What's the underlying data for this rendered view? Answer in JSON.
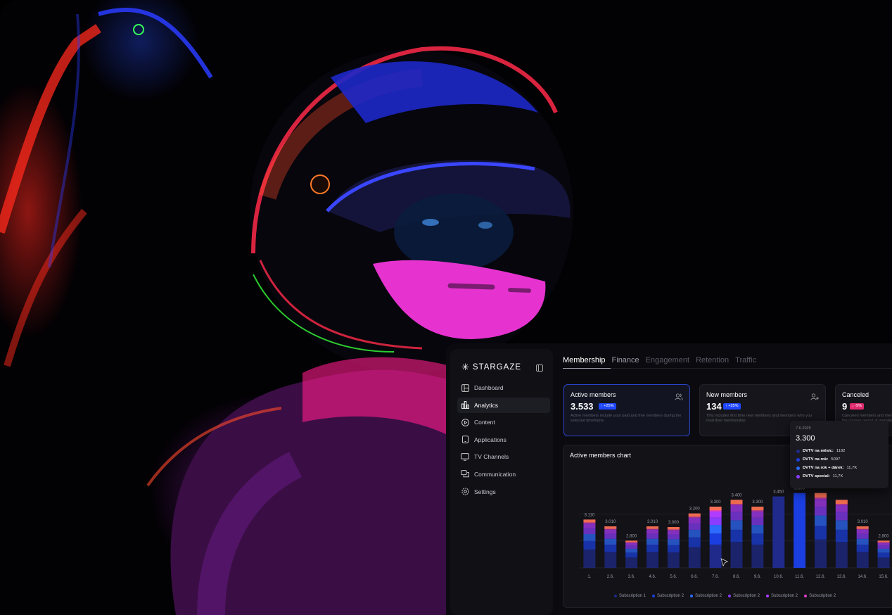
{
  "brand": {
    "name": "STARGAZE"
  },
  "sidebar": {
    "items": [
      {
        "label": "Dashboard",
        "icon": "dashboard-icon"
      },
      {
        "label": "Analytics",
        "icon": "analytics-icon",
        "active": true
      },
      {
        "label": "Content",
        "icon": "play-icon"
      },
      {
        "label": "Applications",
        "icon": "tablet-icon"
      },
      {
        "label": "TV Channels",
        "icon": "tv-icon"
      },
      {
        "label": "Communication",
        "icon": "chat-icon"
      },
      {
        "label": "Settings",
        "icon": "gear-icon"
      }
    ]
  },
  "tabs": [
    "Membership",
    "Finance",
    "Engagement",
    "Retention",
    "Traffic"
  ],
  "cards": [
    {
      "title": "Active members",
      "value": "3.533",
      "badge": "+25%",
      "trend": "up",
      "desc": "Active members include your paid and free members during the selected timeframe."
    },
    {
      "title": "New members",
      "value": "134",
      "badge": "+25%",
      "trend": "up",
      "desc": "This includes first time new members and members who you mod their membership"
    },
    {
      "title": "Canceled",
      "value": "9",
      "badge": "-5%",
      "trend": "down",
      "desc": "Canceled members and members in the chosen period at membership."
    }
  ],
  "chart": {
    "title": "Active members chart",
    "tooltip": {
      "date": "7.6.2025",
      "value": "3.300",
      "rows": [
        {
          "label": "DVTV na měsíc:",
          "value": "1192",
          "color": "#1f2a8a"
        },
        {
          "label": "DVTV na rok:",
          "value": "5097",
          "color": "#1a3ee0"
        },
        {
          "label": "DVTV na rok + dárek:",
          "value": "11,7K",
          "color": "#2d6bff"
        },
        {
          "label": "DVTV special:",
          "value": "11,7K",
          "color": "#8a3cff"
        }
      ]
    },
    "legend": [
      {
        "label": "Subscription 1",
        "color": "#1f2a8a"
      },
      {
        "label": "Subscription 2",
        "color": "#1a3ee0"
      },
      {
        "label": "Subscription 2",
        "color": "#2d6bff"
      },
      {
        "label": "Subscription 2",
        "color": "#8a3cff"
      },
      {
        "label": "Subscription 2",
        "color": "#b03cff"
      },
      {
        "label": "Subscription 2",
        "color": "#e040c8"
      }
    ]
  },
  "chart_data": {
    "type": "bar",
    "title": "Active members chart",
    "categories": [
      "1.",
      "2.6.",
      "3.6.",
      "4.6.",
      "5.6.",
      "6.6.",
      "7.6.",
      "8.6.",
      "9.6.",
      "10.6.",
      "11.6.",
      "12.6.",
      "13.6.",
      "14.6.",
      "15.6."
    ],
    "values": [
      3110,
      3010,
      2800,
      3010,
      3000,
      3200,
      3300,
      3400,
      3300,
      3450,
      3500,
      null,
      null,
      3010,
      2800
    ],
    "value_labels": [
      "3.110",
      "3.010",
      "2.800",
      "3.010",
      "3.000",
      "3.200",
      "3.300",
      "3.400",
      "3.300",
      "3.450",
      "3.500",
      "",
      "",
      "3.010",
      "2.800"
    ],
    "stacked": true,
    "colors": [
      "#1f2a8a",
      "#1a3ee0",
      "#2d6bff",
      "#8a3cff",
      "#b03cff",
      "#e040c8",
      "#ff7a3c"
    ],
    "ylim": [
      0,
      3600
    ],
    "grid": true,
    "legend_position": "bottom"
  }
}
